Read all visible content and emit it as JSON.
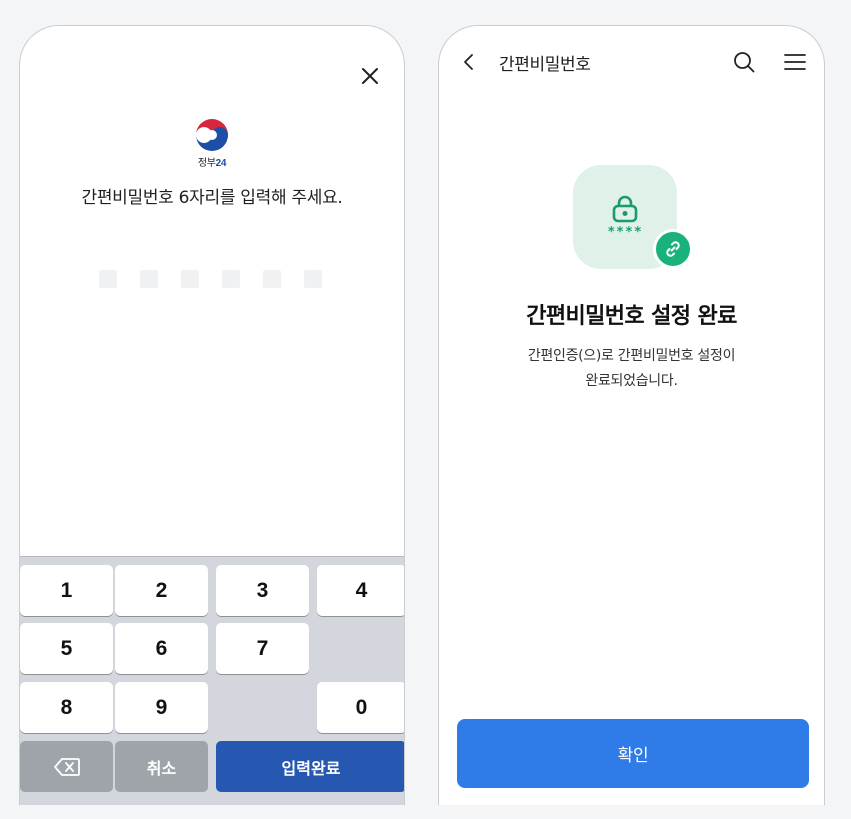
{
  "left_screen": {
    "logo": {
      "icon": "taegeuk-icon",
      "text_prefix": "정부",
      "text_number": "24"
    },
    "prompt": "간편비밀번호 6자리를 입력해 주세요.",
    "close_icon": "close-icon",
    "pin_length": 6,
    "keypad": {
      "digits": [
        "1",
        "2",
        "3",
        "4",
        "5",
        "6",
        "7",
        "8",
        "9",
        "0"
      ],
      "backspace_icon": "backspace-icon",
      "cancel_label": "취소",
      "confirm_label": "입력완료"
    }
  },
  "right_screen": {
    "header": {
      "back_icon": "chevron-left-icon",
      "title": "간편비밀번호",
      "search_icon": "search-icon",
      "menu_icon": "hamburger-menu-icon"
    },
    "illustration": {
      "lock_icon": "lock-icon",
      "stars": "****",
      "badge_icon": "link-icon"
    },
    "title": "간편비밀번호 설정 완료",
    "desc_line1": "간편인증(으)로 간편비밀번호 설정이",
    "desc_line2": "완료되었습니다.",
    "confirm_label": "확인"
  },
  "colors": {
    "keypad_bg": "#d3d6dc",
    "confirm_key": "#2758b1",
    "primary_button": "#2f7be8",
    "success_green": "#19b27b",
    "tile_bg": "#dff1e9"
  }
}
